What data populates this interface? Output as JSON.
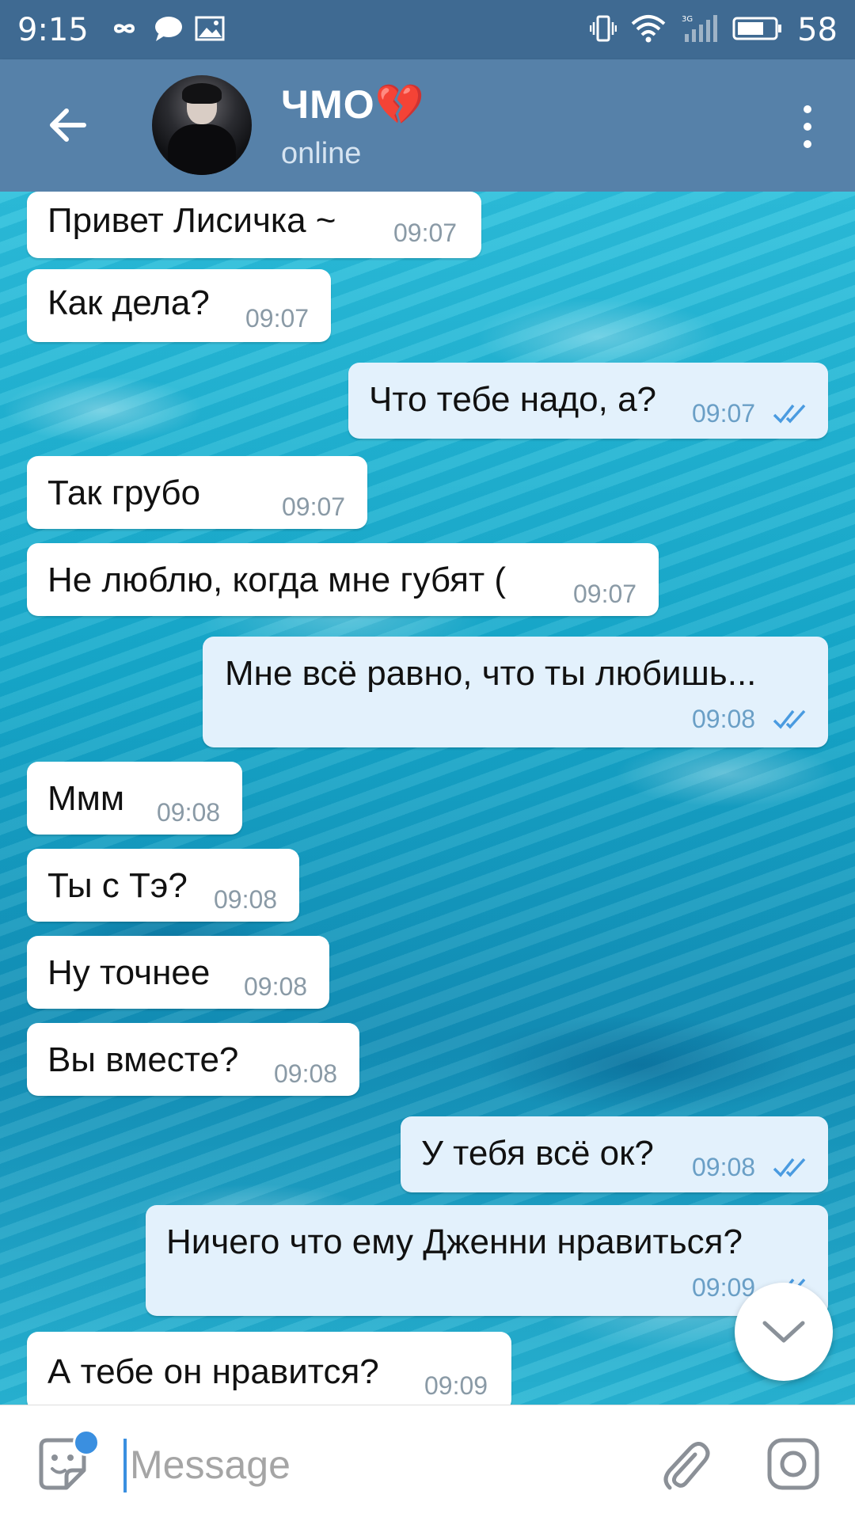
{
  "status_bar": {
    "time": "9:15",
    "battery": "58",
    "network": "3G"
  },
  "header": {
    "title": "ЧМО💔",
    "status": "online"
  },
  "messages": [
    {
      "text": "Привет Лисичка ~",
      "time": "09:07",
      "direction": "in"
    },
    {
      "text": "Как дела?",
      "time": "09:07",
      "direction": "in"
    },
    {
      "text": "Что тебе надо, а?",
      "time": "09:07",
      "direction": "out",
      "read": true
    },
    {
      "text": "Так грубо",
      "time": "09:07",
      "direction": "in"
    },
    {
      "text": "Не люблю, когда мне губят (",
      "time": "09:07",
      "direction": "in"
    },
    {
      "text": "Мне всё равно, что ты любишь...",
      "time": "09:08",
      "direction": "out",
      "read": true
    },
    {
      "text": "Ммм",
      "time": "09:08",
      "direction": "in"
    },
    {
      "text": "Ты с Тэ?",
      "time": "09:08",
      "direction": "in"
    },
    {
      "text": "Ну точнее",
      "time": "09:08",
      "direction": "in"
    },
    {
      "text": "Вы вместе?",
      "time": "09:08",
      "direction": "in"
    },
    {
      "text": "У тебя всё ок?",
      "time": "09:08",
      "direction": "out",
      "read": true
    },
    {
      "text": "Ничего что ему Дженни нравиться?",
      "time": "09:09",
      "direction": "out",
      "read": true
    },
    {
      "text": "А тебе он нравится?",
      "time": "09:09",
      "direction": "in"
    }
  ],
  "composer": {
    "placeholder": "Message"
  },
  "colors": {
    "header": "#5681a9",
    "status_bar": "#3f6a92",
    "incoming_bubble": "#ffffff",
    "outgoing_bubble": "#e3f1fc",
    "read_ticks": "#4a9be0"
  }
}
